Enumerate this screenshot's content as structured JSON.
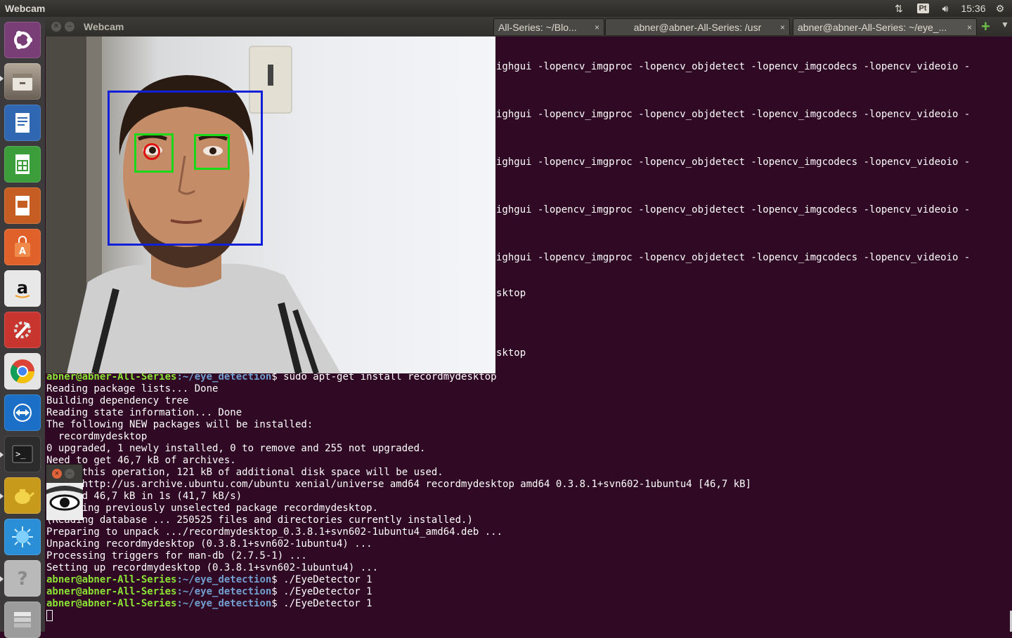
{
  "top_panel": {
    "title": "Webcam",
    "keyboard_layout": "Pt",
    "clock": "15:36"
  },
  "launcher": {
    "items": [
      {
        "name": "ubuntu-dash",
        "icon": "ubuntu-logo-icon",
        "color": "#7a3e76"
      },
      {
        "name": "files",
        "icon": "file-cabinet-icon",
        "color": "#8d7f71"
      },
      {
        "name": "writer",
        "icon": "document-icon",
        "color": "#2f67b2"
      },
      {
        "name": "calc",
        "icon": "spreadsheet-icon",
        "color": "#3b9e3b"
      },
      {
        "name": "impress",
        "icon": "presentation-icon",
        "color": "#c65d22"
      },
      {
        "name": "software-center",
        "icon": "shopping-bag-icon",
        "color": "#e0622a"
      },
      {
        "name": "amazon",
        "icon": "amazon-icon",
        "color": "#e8e8e8"
      },
      {
        "name": "settings",
        "icon": "wrench-icon",
        "color": "#c8352e"
      },
      {
        "name": "chrome",
        "icon": "chrome-icon",
        "color": "#e5e5e5"
      },
      {
        "name": "teamviewer",
        "icon": "teamviewer-icon",
        "color": "#1c6fc7"
      },
      {
        "name": "terminal",
        "icon": "terminal-icon",
        "color": "#2c2c2c"
      },
      {
        "name": "teapot",
        "icon": "teapot-icon",
        "color": "#c89a1c"
      },
      {
        "name": "app",
        "icon": "splash-icon",
        "color": "#2a8fd6"
      },
      {
        "name": "help",
        "icon": "help-icon",
        "color": "#b9b9b9"
      },
      {
        "name": "workspaces",
        "icon": "workspaces-icon",
        "color": "#9c9c9c"
      }
    ]
  },
  "window": {
    "title": "Webcam",
    "tabs": [
      {
        "label": "All-Series: ~/Blo..."
      },
      {
        "label": "abner@abner-All-Series: /usr"
      },
      {
        "label": "abner@abner-All-Series: ~/eye_..."
      }
    ]
  },
  "terminal": {
    "build_line": "ighgui -lopencv_imgproc -lopencv_objdetect -lopencv_imgcodecs -lopencv_videoio -",
    "sktop": "sktop",
    "prompt_user": "abner@abner-All-Series",
    "prompt_path": ":~/eye_detection",
    "prompt_dollar": "$ ",
    "cmd_install": "sudo apt-get install recordmydesktop",
    "cmd_run": "./EyeDetector 1",
    "output": [
      "Reading package lists... Done",
      "Building dependency tree",
      "Reading state information... Done",
      "The following NEW packages will be installed:",
      "  recordmydesktop",
      "0 upgraded, 1 newly installed, 0 to remove and 255 not upgraded.",
      "Need to get 46,7 kB of archives.",
      "      this operation, 121 kB of additional disk space will be used.",
      "      http://us.archive.ubuntu.com/ubuntu xenial/universe amd64 recordmydesktop amd64 0.3.8.1+svn602-1ubuntu4 [46,7 kB]",
      "      d 46,7 kB in 1s (41,7 kB/s)",
      "      ing previously unselected package recordmydesktop.",
      "(Reading database ... 250525 files and directories currently installed.)",
      "Preparing to unpack .../recordmydesktop_0.3.8.1+svn602-1ubuntu4_amd64.deb ...",
      "Unpacking recordmydesktop (0.3.8.1+svn602-1ubuntu4) ...",
      "Processing triggers for man-db (2.7.5-1) ...",
      "Setting up recordmydesktop (0.3.8.1+svn602-1ubuntu4) ..."
    ]
  }
}
